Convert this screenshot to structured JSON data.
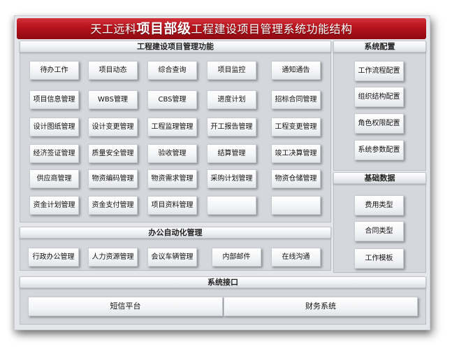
{
  "title": {
    "prefix": "天工远科",
    "highlight": "项目部级",
    "suffix": "工程建设项目管理系统功能结构"
  },
  "main": {
    "header": "工程建设项目管理功能",
    "rows": [
      [
        "待办工作",
        "项目动态",
        "综合查询",
        "项目监控",
        "通知通告"
      ],
      [
        "项目信息管理",
        "WBS管理",
        "CBS管理",
        "进度计划",
        "招标合同管理"
      ],
      [
        "设计图纸管理",
        "设计变更管理",
        "工程监理管理",
        "开工报告管理",
        "工程变更管理"
      ],
      [
        "经济签证管理",
        "质量安全管理",
        "验收管理",
        "结算管理",
        "竣工决算管理"
      ],
      [
        "供应商管理",
        "物资编码管理",
        "物资需求管理",
        "采购计划管理",
        "物资仓储管理"
      ],
      [
        "资金计划管理",
        "资金支付管理",
        "项目资料管理",
        "",
        ""
      ]
    ]
  },
  "office": {
    "header": "办公自动化管理",
    "items": [
      "行政办公管理",
      "人力资源管理",
      "会议车辆管理",
      "内部邮件",
      "在线沟通"
    ]
  },
  "system_config": {
    "header": "系统配置",
    "items": [
      "工作流程配置",
      "组织结构配置",
      "角色权限配置",
      "系统参数配置"
    ]
  },
  "basic_data": {
    "header": "基础数据",
    "items": [
      "费用类型",
      "合同类型",
      "工作模板"
    ]
  },
  "interface": {
    "header": "系统接口",
    "items": [
      "短信平台",
      "财务系统"
    ]
  }
}
